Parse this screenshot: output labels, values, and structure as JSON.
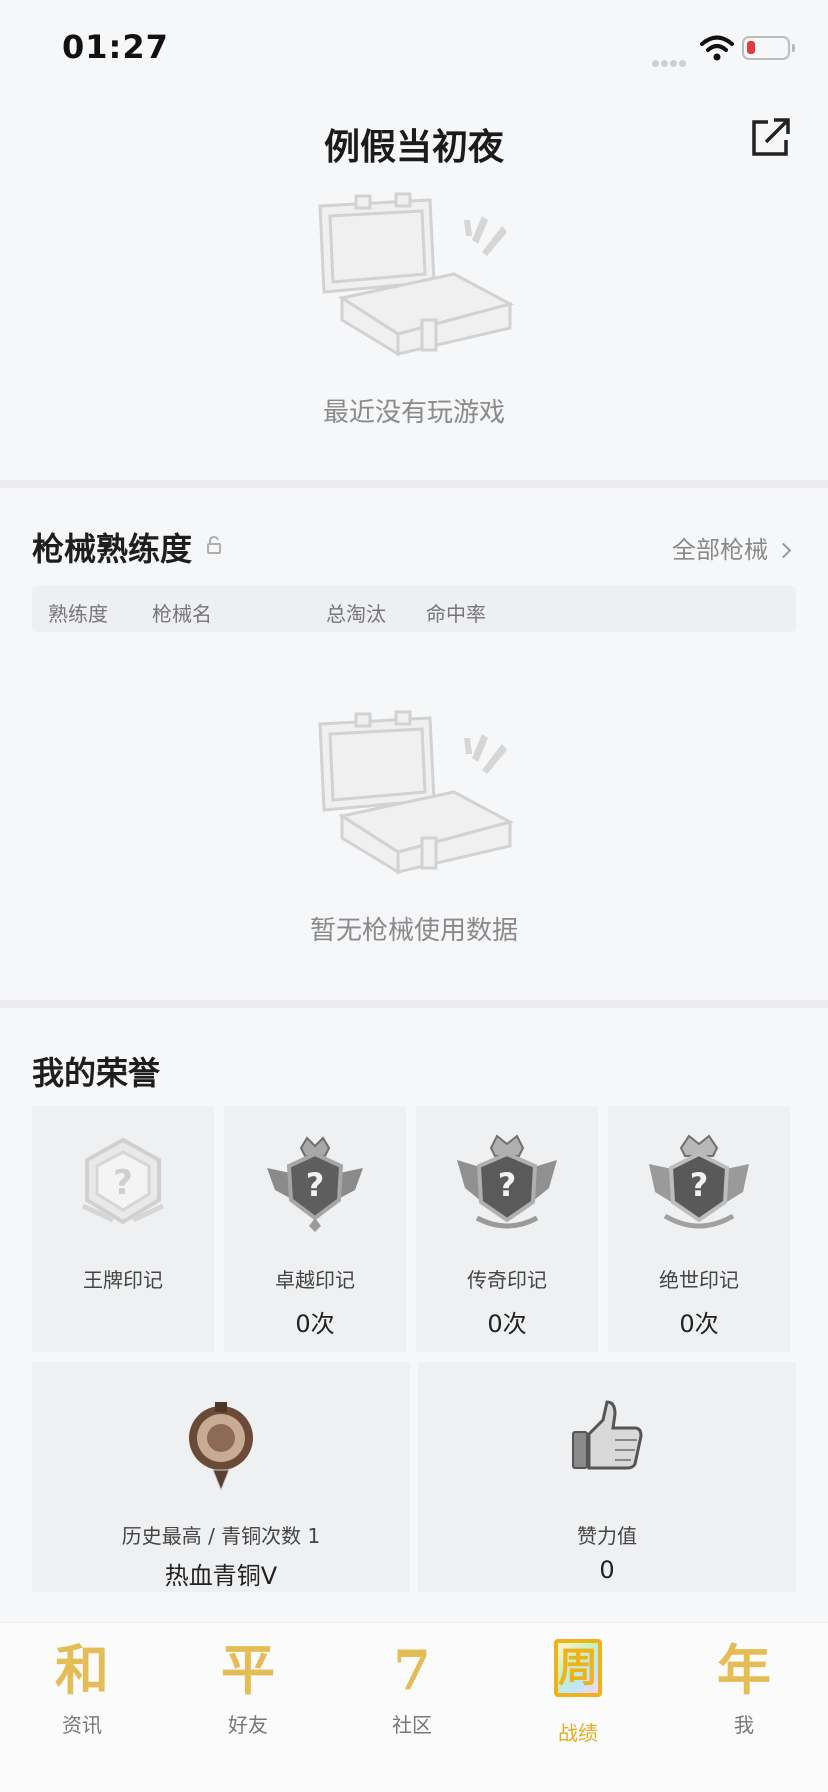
{
  "status_bar": {
    "time": "01:27"
  },
  "header": {
    "title": "例假当初夜"
  },
  "recent_games": {
    "empty_text": "最近没有玩游戏"
  },
  "weapons": {
    "title": "枪械熟练度",
    "all_link": "全部枪械",
    "columns": [
      "熟练度",
      "枪械名",
      "总淘汰",
      "命中率"
    ],
    "empty_text": "暂无枪械使用数据"
  },
  "honors": {
    "title": "我的荣誉",
    "cards": [
      {
        "label": "王牌印记",
        "count": ""
      },
      {
        "label": "卓越印记",
        "count": "0次"
      },
      {
        "label": "传奇印记",
        "count": "0次"
      },
      {
        "label": "绝世印记",
        "count": "0次"
      }
    ],
    "history": {
      "label": "历史最高 / 青铜次数 1",
      "value": "热血青铜Ⅴ"
    },
    "likes": {
      "label": "赞力值",
      "value": "0"
    }
  },
  "tabs": [
    {
      "glyph": "和",
      "label": "资讯"
    },
    {
      "glyph": "平",
      "label": "好友"
    },
    {
      "glyph": "7",
      "label": "社区"
    },
    {
      "glyph": "周",
      "label": "战绩"
    },
    {
      "glyph": "年",
      "label": "我"
    }
  ],
  "colors": {
    "accent": "#e5ad1e",
    "tab_glyph": "#e4bd57"
  }
}
